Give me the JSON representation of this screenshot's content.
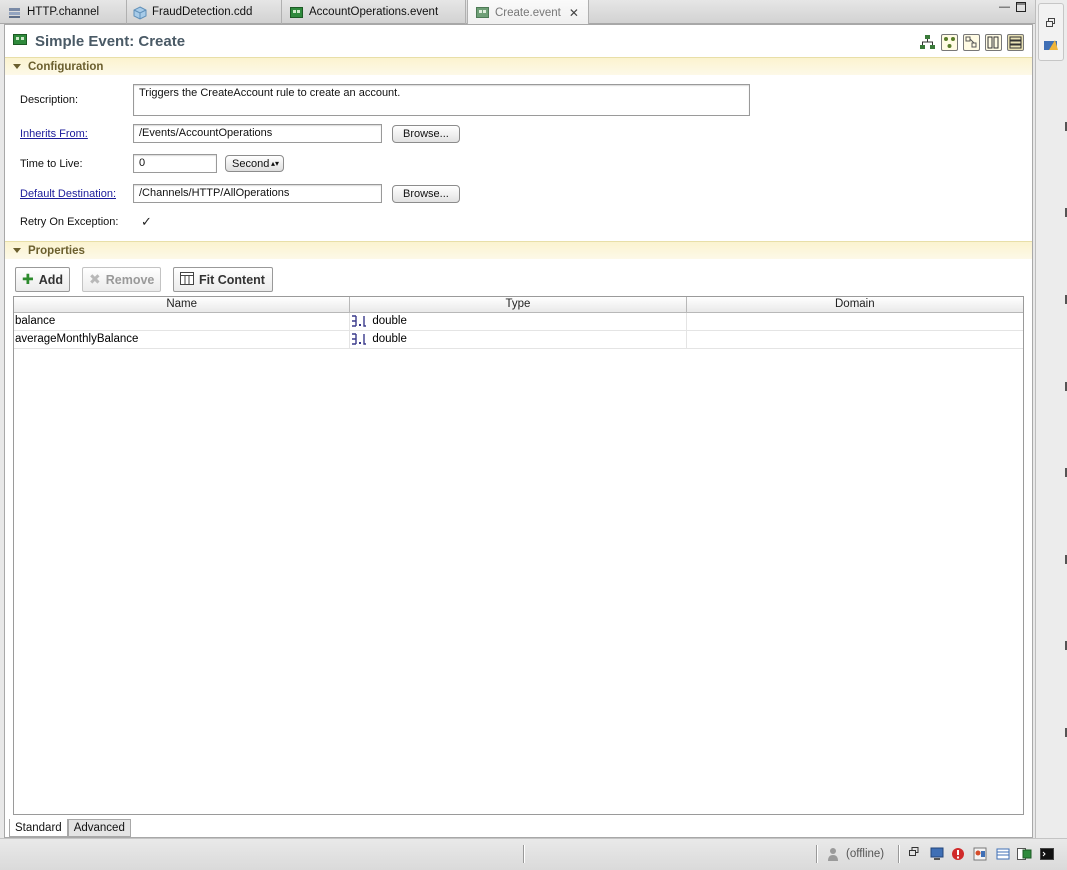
{
  "tabs": [
    {
      "label": "HTTP.channel",
      "icon": "channel-icon"
    },
    {
      "label": "FraudDetection.cdd",
      "icon": "cube-icon"
    },
    {
      "label": "AccountOperations.event",
      "icon": "event-icon"
    },
    {
      "label": "Create.event",
      "icon": "event-icon",
      "active": true
    }
  ],
  "editor": {
    "title": "Simple Event: Create",
    "configuration": {
      "section_label": "Configuration",
      "description_label": "Description:",
      "description_value": "Triggers the CreateAccount rule to create an account.",
      "inherits_label": "Inherits From:",
      "inherits_value": "/Events/AccountOperations",
      "browse_label": "Browse...",
      "ttl_label": "Time to Live:",
      "ttl_value": "0",
      "ttl_unit": "Seconds",
      "dest_label": "Default Destination:",
      "dest_value": "/Channels/HTTP/AllOperations",
      "retry_label": "Retry On Exception:",
      "retry_checked": true
    },
    "properties": {
      "section_label": "Properties",
      "add_label": "Add",
      "remove_label": "Remove",
      "fit_label": "Fit Content",
      "columns": [
        "Name",
        "Type",
        "Domain"
      ],
      "rows": [
        {
          "name": "balance",
          "type": "double",
          "domain": ""
        },
        {
          "name": "averageMonthlyBalance",
          "type": "double",
          "domain": ""
        }
      ]
    },
    "bottom_tabs": [
      "Standard",
      "Advanced"
    ]
  },
  "status": {
    "offline_label": "(offline)"
  },
  "colors": {
    "section_bg": "#fbf3cf",
    "section_text": "#6b5f2e",
    "title_text": "#4a5a66",
    "link": "#1b1b9a"
  }
}
